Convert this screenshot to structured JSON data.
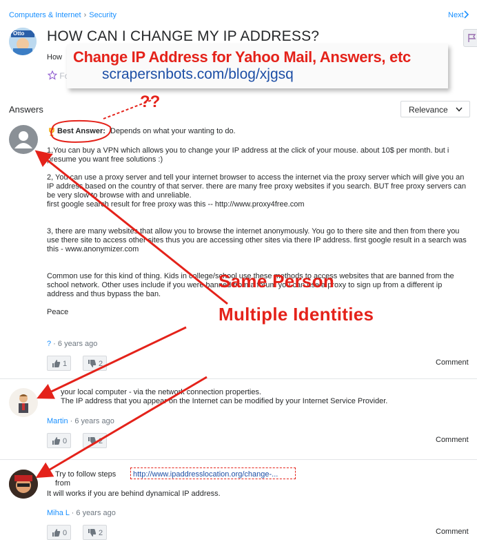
{
  "breadcrumb": {
    "category": "Computers & Internet",
    "subcategory": "Security"
  },
  "nav": {
    "next_label": "Next"
  },
  "question": {
    "title": "HOW CAN I CHANGE MY IP ADDRESS?",
    "subtitle_fragment": "How",
    "follow_label": "Follow",
    "asker_avatar_text": "Otto"
  },
  "promo": {
    "line1": "Change IP Address for Yahoo Mail, Answers, etc",
    "line2": "scrapersnbots.com/blog/xjgsq"
  },
  "answers_header": "Answers",
  "sort": {
    "selected": "Relevance"
  },
  "annotations": {
    "question_marks": "??",
    "same_person": "Same Person",
    "multiple_identities": "Multiple Identities"
  },
  "best_answer_label": "Best Answer:",
  "answers": [
    {
      "intro": " Depends on what your wanting to do.",
      "paragraphs": [
        "1,You can buy a VPN which allows you to change your IP address at the click of your mouse. about 10$ per month. but i presume you want free solutions :)",
        "2, You can use a proxy server and tell your internet browser to access the internet via the proxy server which will give you an IP address based on the country of that server. there are many free proxy websites if you search. BUT free proxy servers can be very slow to browse with and unreliable.\nfirst google search result for free proxy was this -- http://www.proxy4free.com",
        "3, there are many websites that allow you to browse the internet anonymously. You go to there site and then from there you use there site to access other sites thus you are accessing other sites via there IP address. first google result in a search was this - www.anonymizer.com",
        "Common use for this kind of thing. Kids in college/school use these methods to access websites that are banned from the school network. Other uses include if you were banned from a forum you can use a proxy to sign up from a different ip address and thus bypass the ban.",
        "Peace"
      ],
      "author": "?",
      "time": "6 years ago",
      "upvotes": "1",
      "downvotes": "2",
      "comment_label": "Comment"
    },
    {
      "paragraphs": [
        "your local computer - via the network connection properties.\nThe IP address that you appear on the Internet can be modified by your Internet Service Provider."
      ],
      "author": "Martin",
      "time": "6 years ago",
      "upvotes": "0",
      "downvotes": "2",
      "comment_label": "Comment"
    },
    {
      "lead": "Try to follow steps from ",
      "link": "http://www.ipaddresslocation.org/change-...",
      "paragraphs": [
        "It will works if you are behind dynamical IP address."
      ],
      "author": "Miha L",
      "time": "6 years ago",
      "upvotes": "0",
      "downvotes": "2",
      "comment_label": "Comment"
    }
  ],
  "colors": {
    "link": "#188fff",
    "annotation_red": "#e4221a",
    "text": "#26282a",
    "meta": "#6e7780"
  }
}
